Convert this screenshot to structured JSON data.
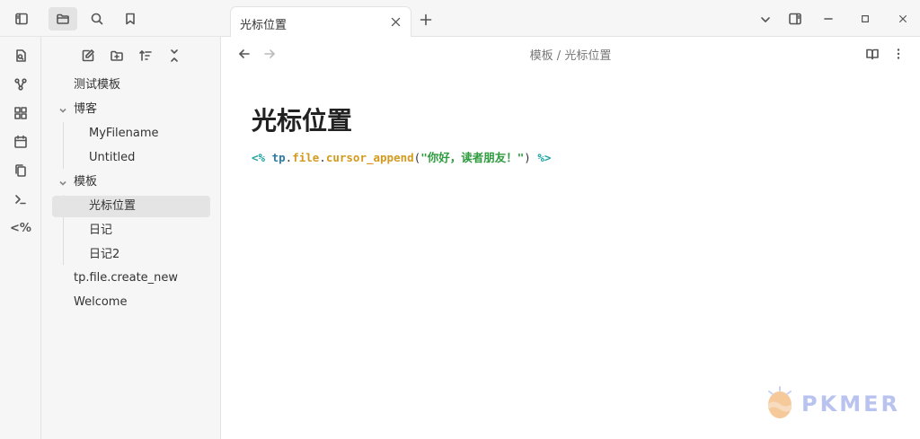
{
  "tabs": [
    {
      "label": "光标位置"
    }
  ],
  "breadcrumb": {
    "folder": "模板",
    "separator": "/",
    "file": "光标位置"
  },
  "tree": {
    "items": [
      {
        "label": "测试模板"
      },
      {
        "label": "博客"
      },
      {
        "label": "MyFilename"
      },
      {
        "label": "Untitled"
      },
      {
        "label": "模板"
      },
      {
        "label": "光标位置"
      },
      {
        "label": "日记"
      },
      {
        "label": "日记2"
      },
      {
        "label": "tp.file.create_new"
      },
      {
        "label": "Welcome"
      }
    ]
  },
  "ribbon": {
    "templater_label": "<%"
  },
  "note": {
    "title": "光标位置",
    "code": {
      "open": "<%",
      "var": "tp",
      "dot1": ".",
      "obj": "file",
      "dot2": ".",
      "fn": "cursor_append",
      "lparen": "(",
      "str": "\"你好，读者朋友！\"",
      "rparen": ")",
      "close": "%>"
    }
  },
  "logo": {
    "text": "PKMER"
  },
  "colors": {
    "accent_teal": "#1aa3a3",
    "string_green": "#2e9b3e",
    "function_orange": "#d39a1f",
    "selected_bg": "#e4e4e4"
  }
}
